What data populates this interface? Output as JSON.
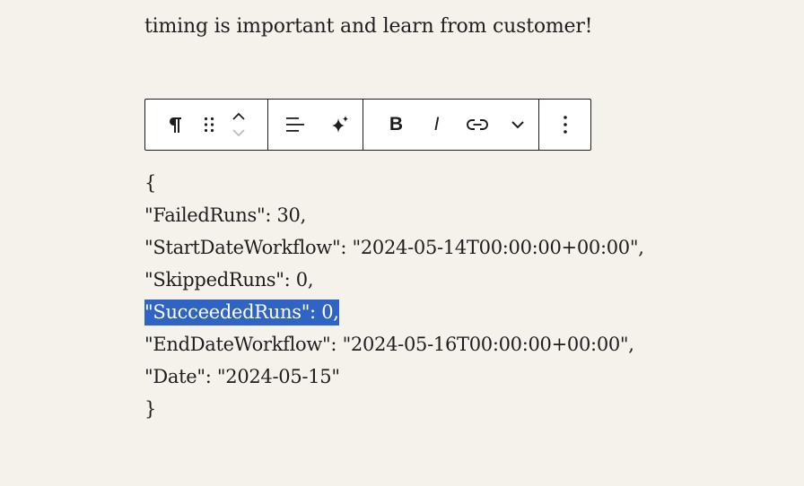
{
  "intro_text": "timing is important and learn from customer!",
  "toolbar": {
    "paragraph_icon": "pilcrow-icon",
    "drag_icon": "drag-handle-icon",
    "move_up_icon": "chevron-up-icon",
    "move_down_icon": "chevron-down-icon",
    "align_icon": "align-left-icon",
    "ai_icon": "sparkle-icon",
    "bold_label": "B",
    "italic_label": "I",
    "link_icon": "link-icon",
    "more_formatting_icon": "chevron-down-icon",
    "options_icon": "vertical-ellipsis-icon"
  },
  "code_block": {
    "open_brace": "{",
    "lines": [
      "\"FailedRuns\": 30,",
      "\"StartDateWorkflow\": \"2024-05-14T00:00:00+00:00\",",
      "\"SkippedRuns\": 0,",
      "\"SucceededRuns\": 0,",
      "\"EndDateWorkflow\": \"2024-05-16T00:00:00+00:00\",",
      "\"Date\": \"2024-05-15\""
    ],
    "close_brace": "}",
    "selected_line_index": 3,
    "selection_color": "#2f64c5"
  }
}
